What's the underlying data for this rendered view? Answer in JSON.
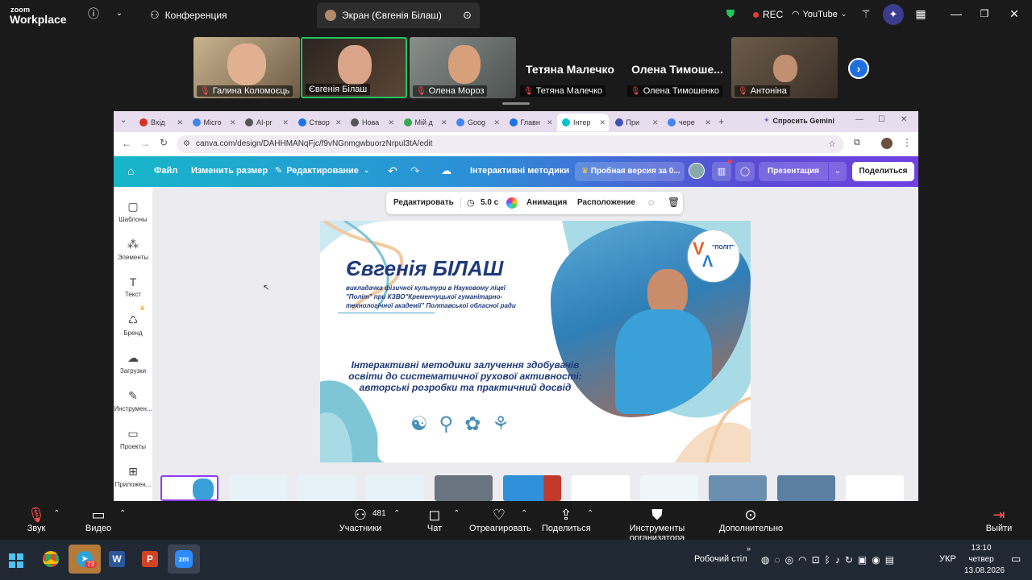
{
  "zoom_top": {
    "logo_small": "zoom",
    "logo_big": "Workplace",
    "meeting_tab": "Конференция",
    "screen_tab": "Экран (Євгенія Білаш)",
    "rec": "REC",
    "youtube": "YouTube"
  },
  "participants": [
    {
      "name": "Галина Коломоєць",
      "muted": true
    },
    {
      "name": "Євгенія Білаш",
      "muted": false,
      "active": true
    },
    {
      "name": "Олена Мороз",
      "muted": true
    },
    {
      "name": "Тетяна Малечко",
      "muted": true,
      "video": false,
      "big_name": "Тетяна Малечко"
    },
    {
      "name": "Олена Тимошенко",
      "muted": true,
      "video": false,
      "big_name": "Олена  Тимоше..."
    },
    {
      "name": "Антоніна",
      "muted": true
    }
  ],
  "browser": {
    "tabs": [
      {
        "label": "Вхід",
        "color": "#d93025"
      },
      {
        "label": "Micro",
        "color": "#4285f4"
      },
      {
        "label": "AI-pr",
        "color": "#555555"
      },
      {
        "label": "Створ",
        "color": "#1a73e8"
      },
      {
        "label": "Нова",
        "color": "#555555"
      },
      {
        "label": "Мій д",
        "color": "#34a853"
      },
      {
        "label": "Goog",
        "color": "#4285f4"
      },
      {
        "label": "Главн",
        "color": "#1a73e8"
      },
      {
        "label": "Інтер",
        "color": "#00c4cc",
        "active": true
      },
      {
        "label": "При",
        "color": "#3f51b5"
      },
      {
        "label": "чере",
        "color": "#4285f4"
      }
    ],
    "gemini": "Спросить Gemini",
    "url": "canva.com/design/DAHHMANqFjc/f9vNGnmgwbuorzNrpul3tA/edit"
  },
  "canva": {
    "file": "Файл",
    "resize": "Изменить размер",
    "editing": "Редактирование",
    "doc_title": "Інтерактивні методики",
    "trial": "Пробная версия за 0...",
    "present": "Презентация",
    "share": "Поделиться",
    "sidebar": [
      "Шаблоны",
      "Элементы",
      "Текст",
      "Бренд",
      "Загрузки",
      "Инструмен...",
      "Проекты",
      "Приложен..."
    ],
    "float_toolbar": {
      "edit": "Редактировать",
      "duration": "5.0 с",
      "animation": "Анимация",
      "position": "Расположение"
    },
    "slide": {
      "name": "Євгенія БІЛАШ",
      "subtitle_1": "викладачка  фізичної культури в Науковому ліцеї",
      "subtitle_2": "\"Політ\" при КЗВО\"Кременчуцької гуманітарно-",
      "subtitle_3": "технологічної академії\"  Полтавської обласної ради",
      "topic_1": "Інтерактивні методики залучення здобувачів",
      "topic_2": "освіти до систематичної рухової активності:",
      "topic_3": "авторські розробки та практичний досвід",
      "logo_text": "\"ПОЛІТ\""
    }
  },
  "zoom_bottom": {
    "audio": "Звук",
    "video": "Видео",
    "participants": "Участники",
    "participants_count": "481",
    "chat": "Чат",
    "react": "Отреагировать",
    "share": "Поделиться",
    "host_tools": "Инструменты организатора",
    "more": "Дополнительно",
    "leave": "Выйти"
  },
  "taskbar": {
    "desktop": "Робочий стіл",
    "telegram_badge": "73",
    "lang": "УКР",
    "time": "13:10",
    "day": "четвер",
    "date": "13.08.2026"
  }
}
